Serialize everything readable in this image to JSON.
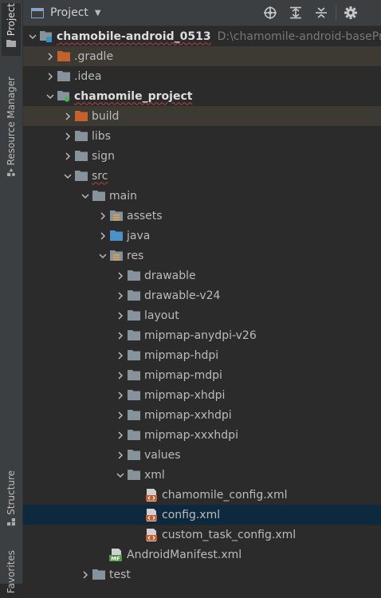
{
  "side_tabs": {
    "project": "Project",
    "resource_manager": "Resource Manager",
    "structure": "Structure",
    "favorites": "Favorites"
  },
  "toolbar": {
    "title": "Project",
    "icons": [
      "target-icon",
      "expand-all-icon",
      "collapse-all-icon",
      "gear-icon"
    ]
  },
  "tree": {
    "root": {
      "name": "chamobile-android_0513",
      "path": "D:\\chamomile-android-basePro"
    },
    "gradle": ".gradle",
    "idea": ".idea",
    "project": "chamomile_project",
    "build": "build",
    "libs": "libs",
    "sign": "sign",
    "src": "src",
    "main": "main",
    "assets": "assets",
    "java": "java",
    "res": "res",
    "drawable": "drawable",
    "drawable_v24": "drawable-v24",
    "layout": "layout",
    "mipmap_anydpi": "mipmap-anydpi-v26",
    "mipmap_hdpi": "mipmap-hdpi",
    "mipmap_mdpi": "mipmap-mdpi",
    "mipmap_xhdpi": "mipmap-xhdpi",
    "mipmap_xxhdpi": "mipmap-xxhdpi",
    "mipmap_xxxhdpi": "mipmap-xxxhdpi",
    "values": "values",
    "xml": "xml",
    "chamomile_config": "chamomile_config.xml",
    "config": "config.xml",
    "custom_task_config": "custom_task_config.xml",
    "manifest": "AndroidManifest.xml",
    "manifest_badge": "MF",
    "test": "test"
  },
  "colors": {
    "excluded_folder": "#c5622b",
    "folder": "#87939a",
    "source_folder": "#4a93c8",
    "selection": "#0d293e"
  }
}
